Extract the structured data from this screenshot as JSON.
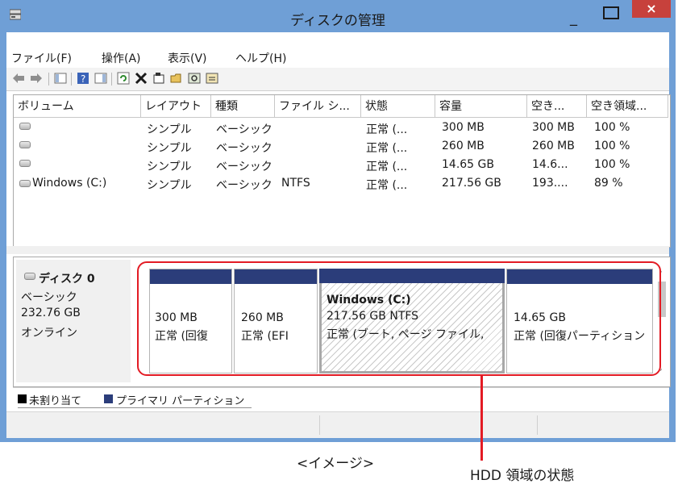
{
  "window": {
    "title": "ディスクの管理",
    "minimize": "_",
    "close": "×"
  },
  "menu": [
    "ファイル(F)",
    "操作(A)",
    "表示(V)",
    "ヘルプ(H)"
  ],
  "toolbar_icons": [
    "back-arrow-icon",
    "forward-arrow-icon",
    "console-tree-icon",
    "help-icon",
    "action-pane-icon",
    "refresh-icon",
    "delete-icon",
    "properties-icon",
    "open-icon",
    "search-icon",
    "rescan-icon"
  ],
  "columns": [
    "ボリューム",
    "レイアウト",
    "種類",
    "ファイル シ...",
    "状態",
    "容量",
    "空き...",
    "空き領域..."
  ],
  "volumes": [
    {
      "name": "",
      "layout": "シンプル",
      "type": "ベーシック",
      "fs": "",
      "status": "正常 (...",
      "capacity": "300 MB",
      "free": "300 MB",
      "pct": "100 %"
    },
    {
      "name": "",
      "layout": "シンプル",
      "type": "ベーシック",
      "fs": "",
      "status": "正常 (...",
      "capacity": "260 MB",
      "free": "260 MB",
      "pct": "100 %"
    },
    {
      "name": "",
      "layout": "シンプル",
      "type": "ベーシック",
      "fs": "",
      "status": "正常 (...",
      "capacity": "14.65 GB",
      "free": "14.6...",
      "pct": "100 %"
    },
    {
      "name": "Windows (C:)",
      "layout": "シンプル",
      "type": "ベーシック",
      "fs": "NTFS",
      "status": "正常 (...",
      "capacity": "217.56 GB",
      "free": "193....",
      "pct": "89 %"
    }
  ],
  "disk": {
    "name": "ディスク 0",
    "type": "ベーシック",
    "size": "232.76 GB",
    "state": "オンライン"
  },
  "partitions": [
    {
      "title": "",
      "size": "300 MB",
      "status": "正常 (回復"
    },
    {
      "title": "",
      "size": "260 MB",
      "status": "正常 (EFI"
    },
    {
      "title": "Windows  (C:)",
      "size": "217.56 GB NTFS",
      "status": "正常 (ブート, ページ ファイル,"
    },
    {
      "title": "",
      "size": "14.65 GB",
      "status": "正常 (回復パーティション"
    }
  ],
  "legend": {
    "unallocated": "未割り当て",
    "primary": "プライマリ パーティション",
    "unallocated_color": "#000000",
    "primary_color": "#2b3d7a"
  },
  "captions": {
    "image_note": "<イメージ>",
    "callout": "HDD 領域の状態"
  },
  "colors": {
    "titlebar": "#6f9fd6",
    "close": "#c7413c",
    "highlight": "#e31b24"
  }
}
